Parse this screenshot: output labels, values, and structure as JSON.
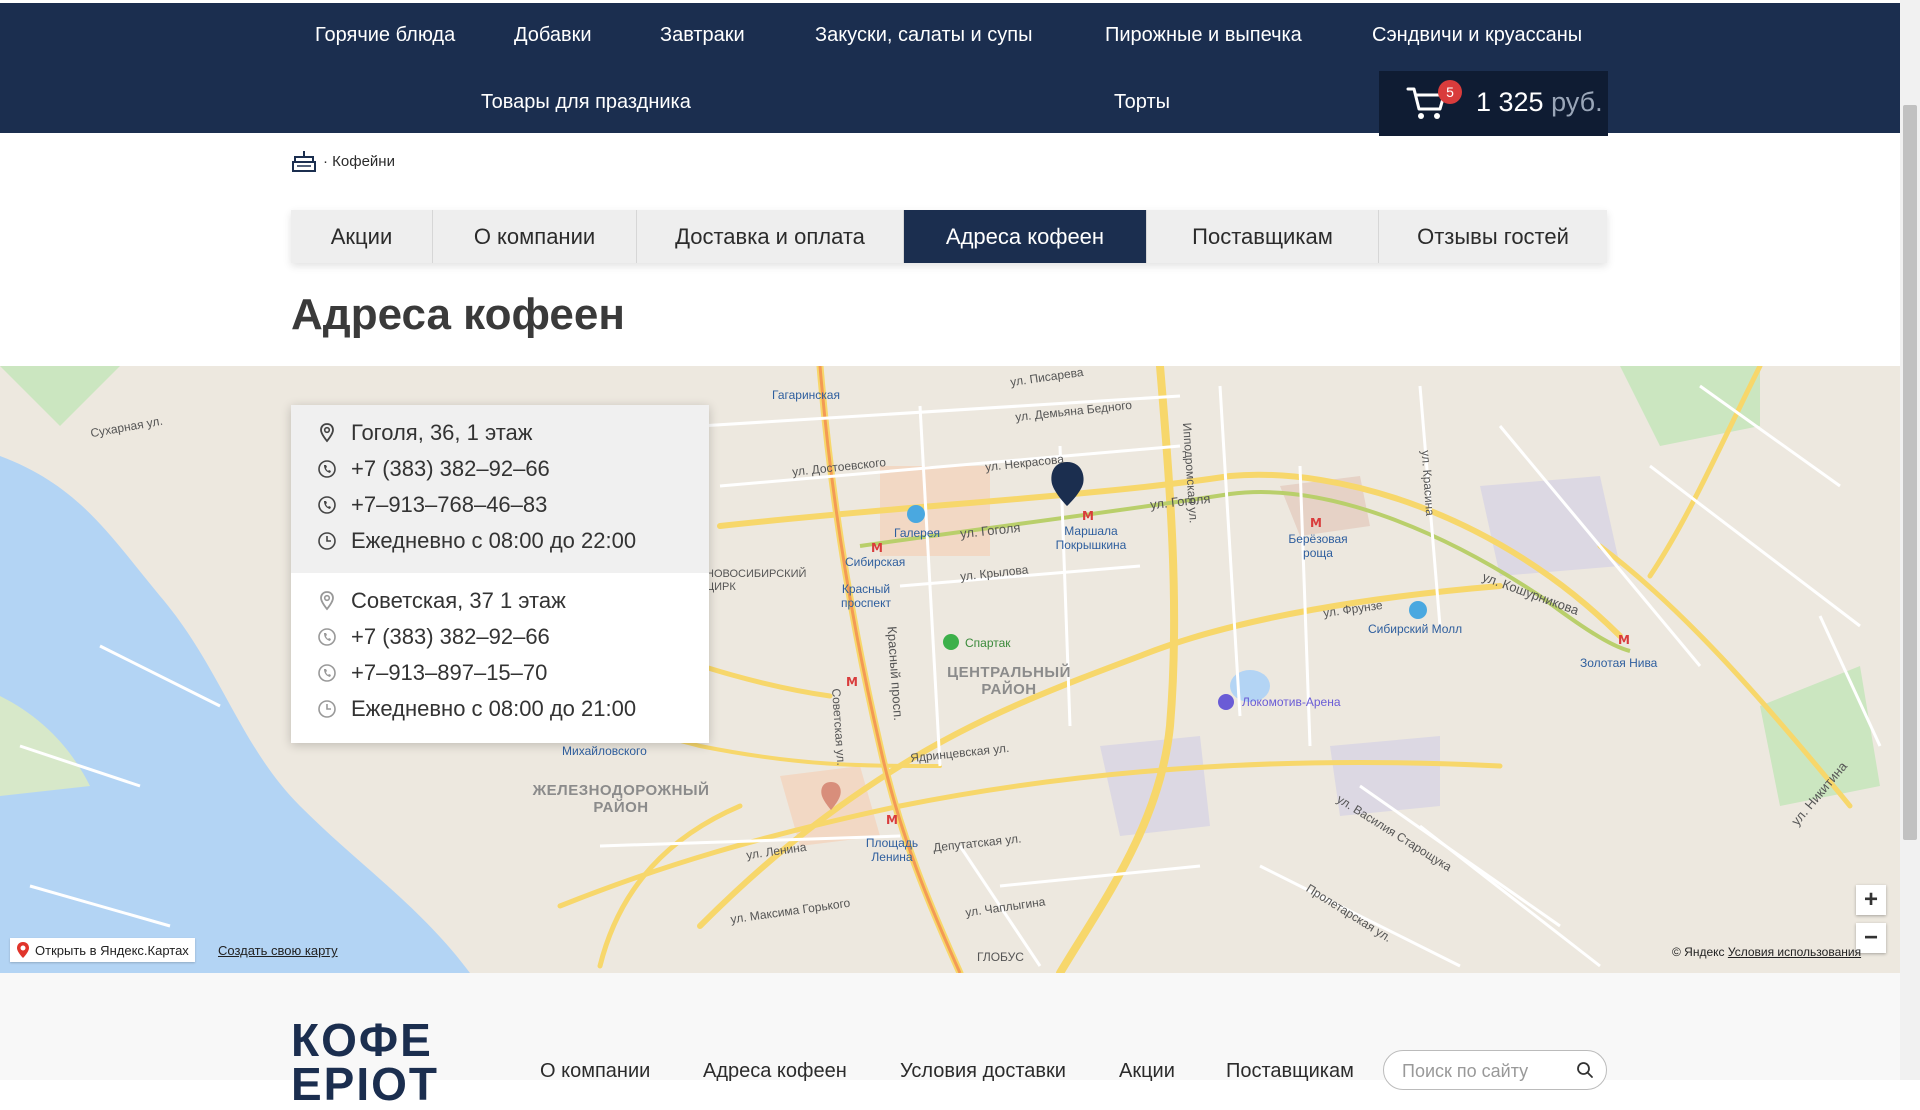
{
  "nav": {
    "row1": [
      "Горячие блюда",
      "Добавки",
      "Завтраки",
      "Закуски, салаты и супы",
      "Пирожные и выпечка",
      "Сэндвичи и круассаны"
    ],
    "row2": [
      "Товары для праздника",
      "Торты"
    ]
  },
  "cart": {
    "count": "5",
    "total": "1 325",
    "currency": "руб."
  },
  "breadcrumb": {
    "current": "· Кофейни"
  },
  "tabs": [
    "Акции",
    "О компании",
    "Доставка и оплата",
    "Адреса кофеен",
    "Поставщикам",
    "Отзывы гостей"
  ],
  "active_tab": "Адреса кофеен",
  "page_title": "Адреса кофеен",
  "locations": [
    {
      "address": "Гоголя, 36, 1 этаж",
      "phone1": "+7 (383) 382–92–66",
      "phone2": "+7–913–768–46–83",
      "hours": "Ежедневно с 08:00 до 22:00"
    },
    {
      "address": "Советская, 37 1 этаж",
      "phone1": "+7 (383) 382–92–66",
      "phone2": "+7–913–897–15–70",
      "hours": "Ежедневно с 08:00 до 21:00"
    }
  ],
  "map": {
    "labels": {
      "pisareva": "ул. Писарева",
      "dem_bednogo": "ул. Демьяна Бедного",
      "nekrasova": "ул. Некрасова",
      "dostoevskogo": "ул. Достоевского",
      "gogolya1": "ул. Гоголя",
      "gogolya2": "ул. Гоголя",
      "krylova": "ул. Крылова",
      "frunze": "ул. Фрунзе",
      "koshurnikova": "ул. Кошурникова",
      "gagarinskaya": "Гагаринская",
      "galereya": "Галерея",
      "sibirskaya": "Сибирская",
      "krasny_prospekt": "Красный проспект",
      "marshala": "Маршала Покрышкина",
      "berezovaya": "Берёзовая роща",
      "sib_mall": "Сибирский Молл",
      "zolotaya_niva": "Золотая Нива",
      "spartak": "Спартак",
      "central": "ЦЕНТРАЛЬНЫЙ РАЙОН",
      "lokomotiv": "Локомотив-Арена",
      "zheleznodorozhny": "ЖЕЛЕЗНОДОРОЖНЫЙ РАЙОН",
      "ploshchad_lenina": "Площадь Ленина",
      "lenina": "ул. Ленина",
      "max_gorkogo": "ул. Максима Горького",
      "chaplygina": "ул. Чаплыгина",
      "globus": "ГЛОБУС",
      "deputatskaya": "Депутатская ул.",
      "mikhailovskogo": "Михайловского",
      "magistral": "Ядринцевская ул.",
      "krasny_prosp_v": "Красный просп.",
      "sovetskaya_v": "Советская ул.",
      "ippodromskaya": "Ипподромская ул.",
      "vasiliya": "ул. Василия Старощука",
      "krasina": "ул. Красина",
      "sukharnaya": "Сухарная ул.",
      "circus": "НОВОСИБИРСКИЙ ЦИРК",
      "nikitina": "ул. Никитина",
      "proletarskaya": "Пролетарская ул."
    },
    "open_link": "Открыть в Яндекс.Картах",
    "create_link": "Создать свою карту",
    "copyright": "© Яндекс",
    "terms": "Условия использования",
    "zoom_in": "+",
    "zoom_out": "−"
  },
  "footer": {
    "logo_line1": "КОФЕ",
    "logo_line2": "ЕРІОТ",
    "links": [
      "О компании",
      "Адреса кофеен",
      "Условия доставки",
      "Акции",
      "Поставщикам"
    ],
    "search_placeholder": "Поиск по сайту"
  },
  "colors": {
    "navy": "#1b2e4f",
    "cart_bg": "#0f1c33",
    "badge": "#d93c3c",
    "metro": "#d93c3c",
    "water": "#b3d4f4",
    "park": "#cbe6c0",
    "pin": "#1b2e4f",
    "pin2": "#d88e7b"
  }
}
